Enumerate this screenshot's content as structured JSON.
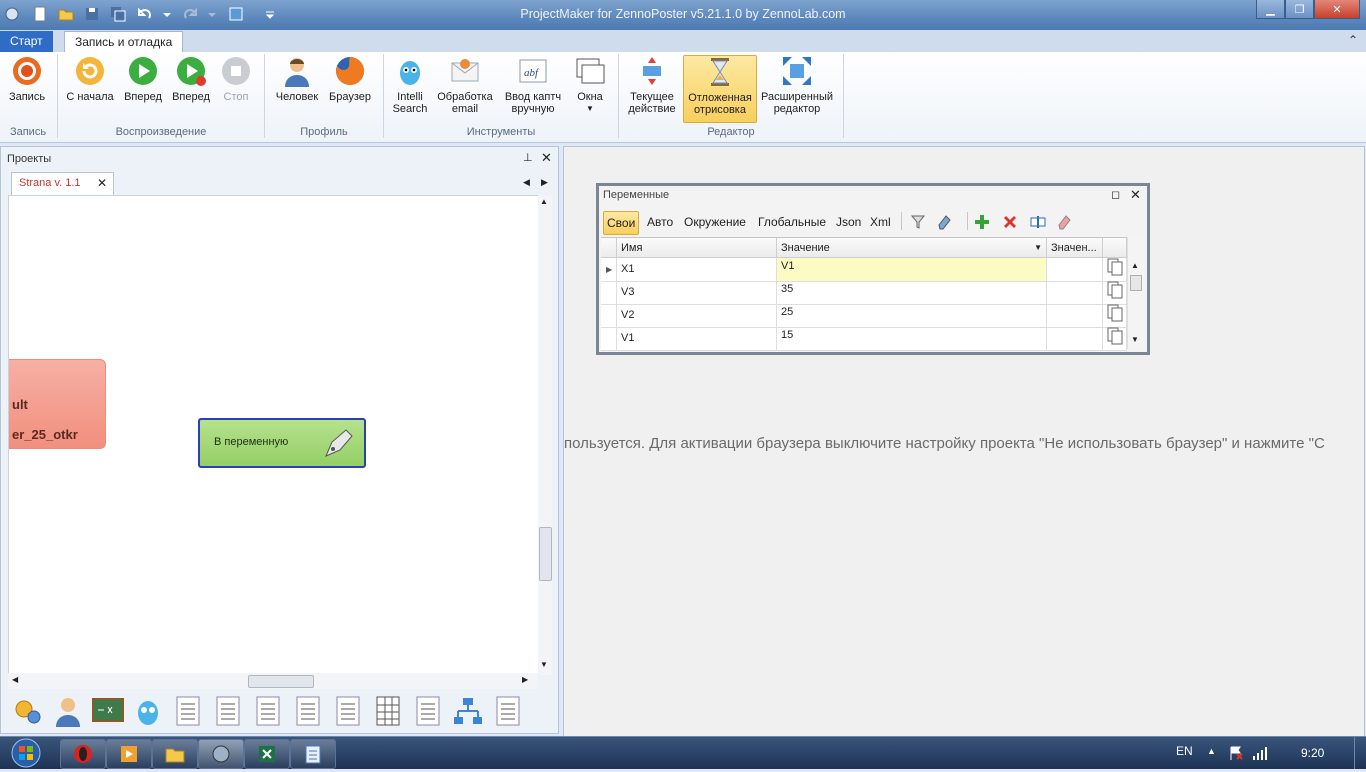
{
  "window": {
    "title": "ProjectMaker for ZennoPoster v5.21.1.0 by ZennoLab.com"
  },
  "ribbon_tabs": {
    "start": "Старт",
    "active": "Запись и отладка"
  },
  "ribbon": {
    "buttons": {
      "record": "Запись",
      "from_start": "С начала",
      "forward": "Вперед",
      "forward2": "Вперед",
      "stop": "Стоп",
      "human": "Человек",
      "browser": "Браузер",
      "intelli_1": "Intelli",
      "intelli_2": "Search",
      "email_1": "Обработка",
      "email_2": "email",
      "captcha_1": "Ввод каптч",
      "captcha_2": "вручную",
      "windows": "Окна",
      "current_1": "Текущее",
      "current_2": "действие",
      "deferred_1": "Отложенная",
      "deferred_2": "отрисовка",
      "advanced_1": "Расширенный",
      "advanced_2": "редактор"
    },
    "groups": {
      "record": "Запись",
      "playback": "Воспроизведение",
      "profile": "Профиль",
      "tools": "Инструменты",
      "editor": "Редактор"
    }
  },
  "projects_panel": {
    "title": "Проекты",
    "tab_label": "Strana v. 1.1",
    "node_partial_line1": "ult",
    "node_partial_line2": "er_25_otkr",
    "node_action_label": "В переменную"
  },
  "browser_area": {
    "message": "пользуется. Для активации браузера выключите настройку проекта \"Не использовать браузер\" и нажмите \"С"
  },
  "variables_window": {
    "title": "Переменные",
    "tabs": [
      "Свои",
      "Авто",
      "Окружение",
      "Глобальные",
      "Json",
      "Xml"
    ],
    "columns": {
      "name": "Имя",
      "value": "Значение",
      "value2": "Значен..."
    },
    "rows": [
      {
        "name": "X1",
        "value": "V1"
      },
      {
        "name": "V3",
        "value": "35"
      },
      {
        "name": "V2",
        "value": "25"
      },
      {
        "name": "V1",
        "value": "15"
      }
    ]
  },
  "taskbar": {
    "lang": "EN",
    "time": "9:20"
  }
}
